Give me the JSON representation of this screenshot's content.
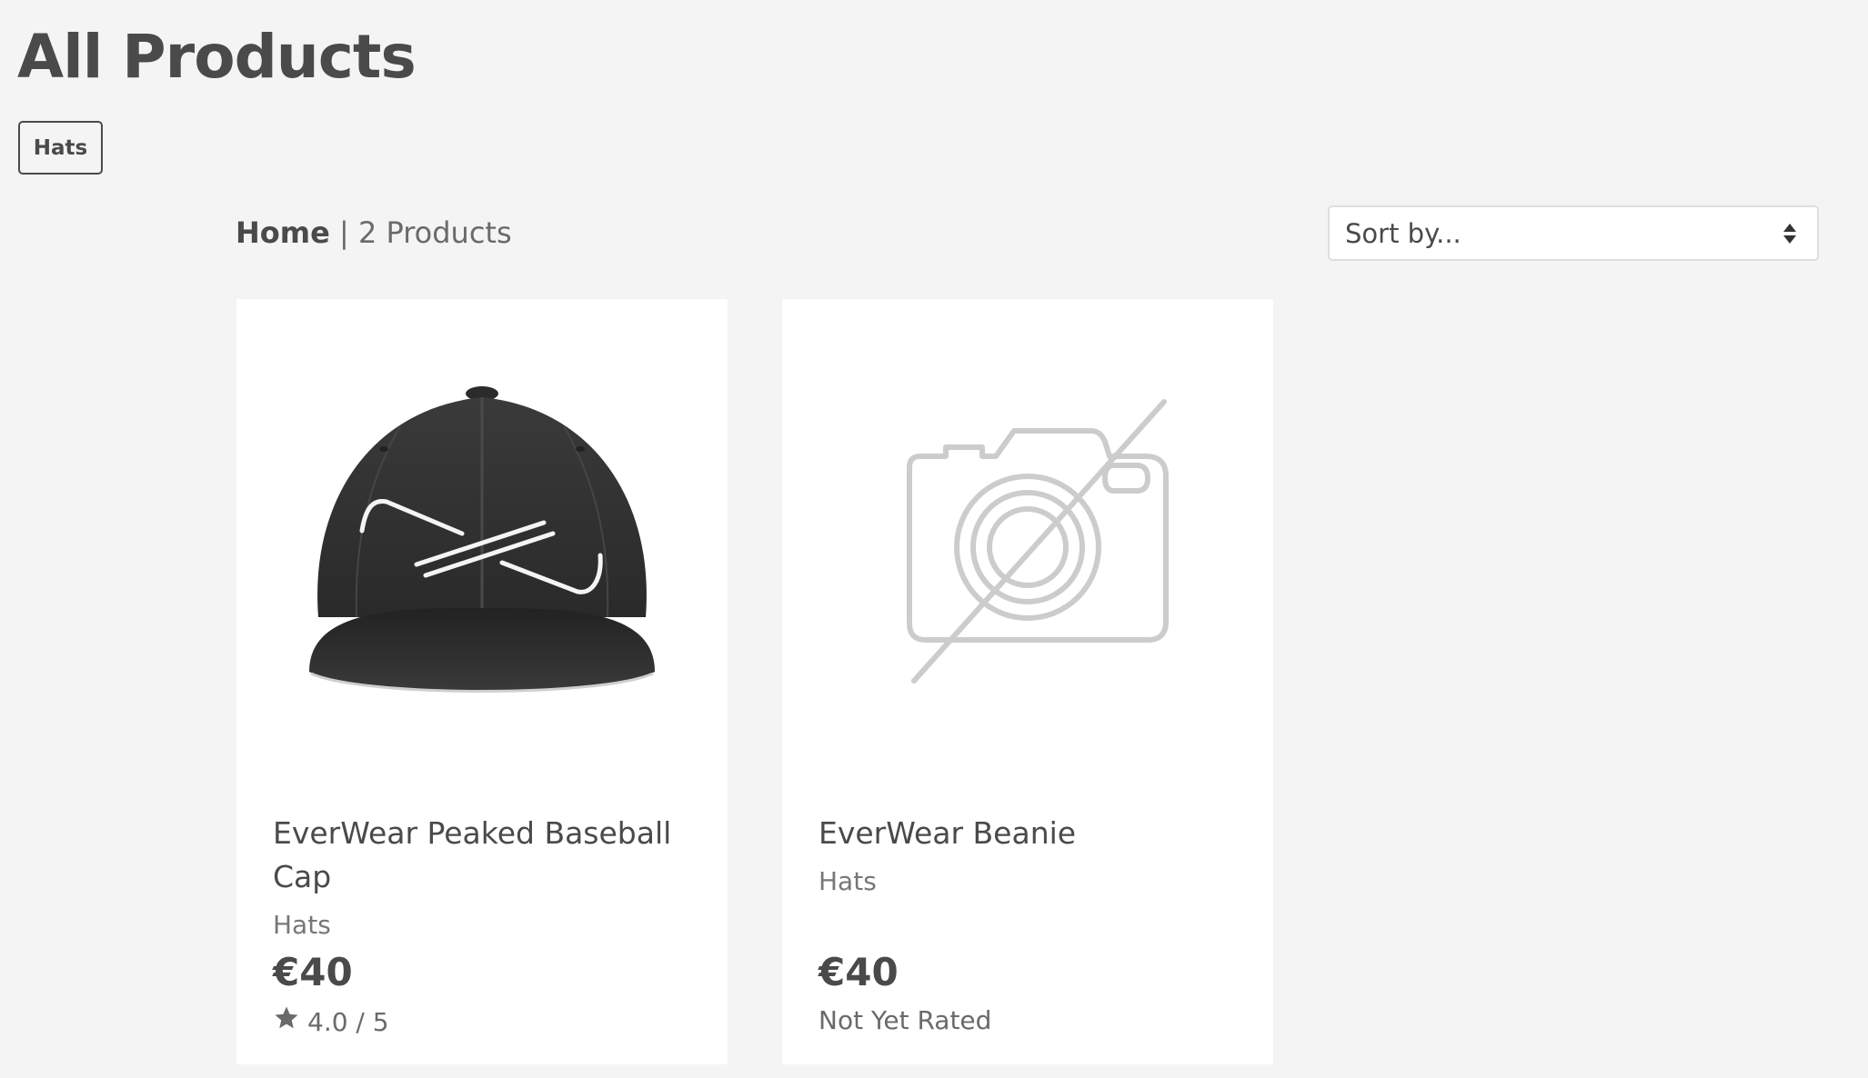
{
  "page": {
    "title": "All Products"
  },
  "filters": {
    "tags": [
      "Hats"
    ]
  },
  "breadcrumb": {
    "home": "Home",
    "separator": "|",
    "count": "2 Products"
  },
  "sort": {
    "label": "Sort by..."
  },
  "products": [
    {
      "name": "EverWear Peaked Baseball Cap",
      "category": "Hats",
      "price": "€40",
      "rating": "4.0 / 5",
      "image_icon": "baseball-cap-image"
    },
    {
      "name": "EverWear Beanie",
      "category": "Hats",
      "price": "€40",
      "rating": "Not Yet Rated",
      "image_icon": "no-image-camera-icon"
    }
  ],
  "colors": {
    "background": "#f4f4f4",
    "card": "#ffffff",
    "text_dark": "#4a4a4a",
    "text_muted": "#777777"
  }
}
